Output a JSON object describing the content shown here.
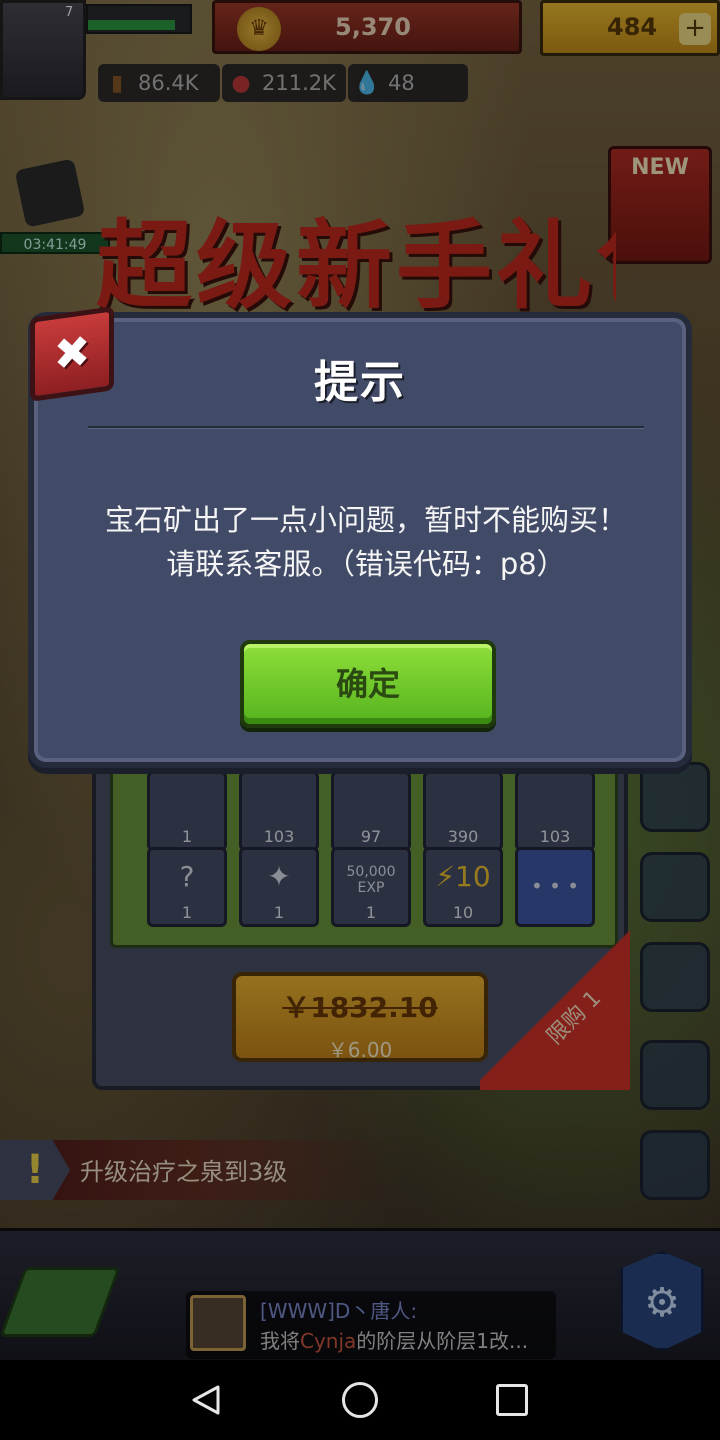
{
  "top_bar": {
    "level": "7",
    "xp_progress": 0.85,
    "gold": "5,370",
    "gems": "484",
    "wood": "86.4K",
    "meat": "211.2K",
    "water": "48"
  },
  "timer": "03:41:49",
  "new_gift_label": "NEW",
  "banner_title": "超级新手礼包",
  "dialog": {
    "title": "提示",
    "message_line1": "宝石矿出了一点小问题，暂时不能购买！",
    "message_line2": "请联系客服。（错误代码：p8）",
    "ok_label": "确定",
    "close_glyph": "✖"
  },
  "shop": {
    "row1": [
      "1",
      "103",
      "97",
      "390",
      "103"
    ],
    "row2": [
      {
        "glyph": "?",
        "count": "1"
      },
      {
        "glyph": "✦",
        "count": "1"
      },
      {
        "glyph": "50,000 EXP",
        "count": "1"
      },
      {
        "glyph": "⚡10",
        "count": "10"
      },
      {
        "glyph": "• • •",
        "count": ""
      }
    ],
    "old_price": "￥1832.10",
    "new_price": "￥6.00",
    "limit_label": "限购",
    "limit_count": "1"
  },
  "quest_alert": "!",
  "quest_text": "升级治疗之泉到3级",
  "chat": {
    "name": "[WWW]D丶唐人:",
    "message_prefix": "我将",
    "highlight": "Cynja",
    "message_suffix": "的阶层从阶层1改..."
  },
  "settings_glyph": "⚙",
  "colors": {
    "dialog_bg": "#414a66",
    "ok_green": "#6cc828",
    "close_red": "#c83b3b"
  },
  "icons": [
    "gold-coin-icon",
    "gem-icon",
    "wood-icon",
    "meat-icon",
    "water-drop-icon",
    "close-icon",
    "settings-gear-icon",
    "map-icon",
    "back-icon",
    "home-icon",
    "recent-apps-icon"
  ]
}
